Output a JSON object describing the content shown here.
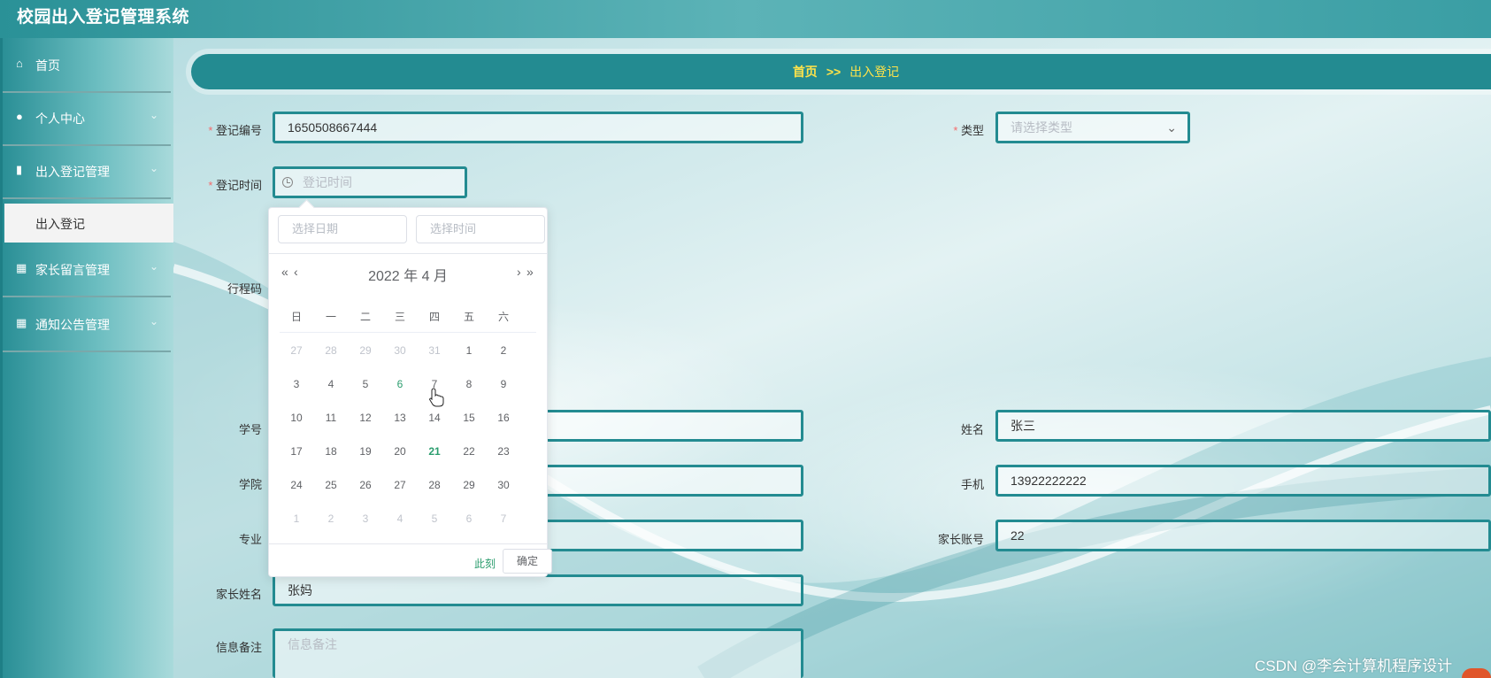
{
  "app": {
    "title": "校园出入登记管理系统"
  },
  "sidebar": {
    "items": [
      {
        "label": "首页",
        "icon": "home-icon"
      },
      {
        "label": "个人中心",
        "icon": "user-icon"
      },
      {
        "label": "出入登记管理",
        "icon": "book-icon"
      },
      {
        "label": "家长留言管理",
        "icon": "grid-icon"
      },
      {
        "label": "通知公告管理",
        "icon": "grid-icon"
      }
    ],
    "sub_item": {
      "label": "出入登记"
    }
  },
  "breadcrumb": {
    "home": "首页",
    "separator": ">>",
    "current": "出入登记"
  },
  "form": {
    "reg_no": {
      "label": "登记编号",
      "value": "1650508667444"
    },
    "type": {
      "label": "类型",
      "placeholder": "请选择类型"
    },
    "reg_time": {
      "label": "登记时间",
      "placeholder": "登记时间"
    },
    "trip_code": {
      "label": "行程码"
    },
    "student_no": {
      "label": "学号"
    },
    "name": {
      "label": "姓名",
      "value": "张三"
    },
    "college": {
      "label": "学院"
    },
    "phone": {
      "label": "手机",
      "value": "13922222222"
    },
    "major": {
      "label": "专业"
    },
    "parent_account": {
      "label": "家长账号",
      "value": "22"
    },
    "parent_name": {
      "label": "家长姓名",
      "value": "张妈"
    },
    "remark": {
      "label": "信息备注",
      "placeholder": "信息备注"
    }
  },
  "date_picker": {
    "date_placeholder": "选择日期",
    "time_placeholder": "选择时间",
    "header": "2022 年  4 月",
    "prev_year": "«",
    "prev_month": "‹",
    "next_month": "›",
    "next_year": "»",
    "weekdays": [
      "日",
      "一",
      "二",
      "三",
      "四",
      "五",
      "六"
    ],
    "weeks": [
      [
        "27",
        "28",
        "29",
        "30",
        "31",
        "1",
        "2"
      ],
      [
        "3",
        "4",
        "5",
        "6",
        "7",
        "8",
        "9"
      ],
      [
        "10",
        "11",
        "12",
        "13",
        "14",
        "15",
        "16"
      ],
      [
        "17",
        "18",
        "19",
        "20",
        "21",
        "22",
        "23"
      ],
      [
        "24",
        "25",
        "26",
        "27",
        "28",
        "29",
        "30"
      ],
      [
        "1",
        "2",
        "3",
        "4",
        "5",
        "6",
        "7"
      ]
    ],
    "today": "21",
    "hovered": "6",
    "now_label": "此刻",
    "ok_label": "确定"
  },
  "watermark": "CSDN @李会计算机程序设计",
  "colors": {
    "accent": "#238b91",
    "breadcrumb_text": "#ffe34a",
    "today": "#2b9d6e",
    "required": "#f56c6c"
  }
}
